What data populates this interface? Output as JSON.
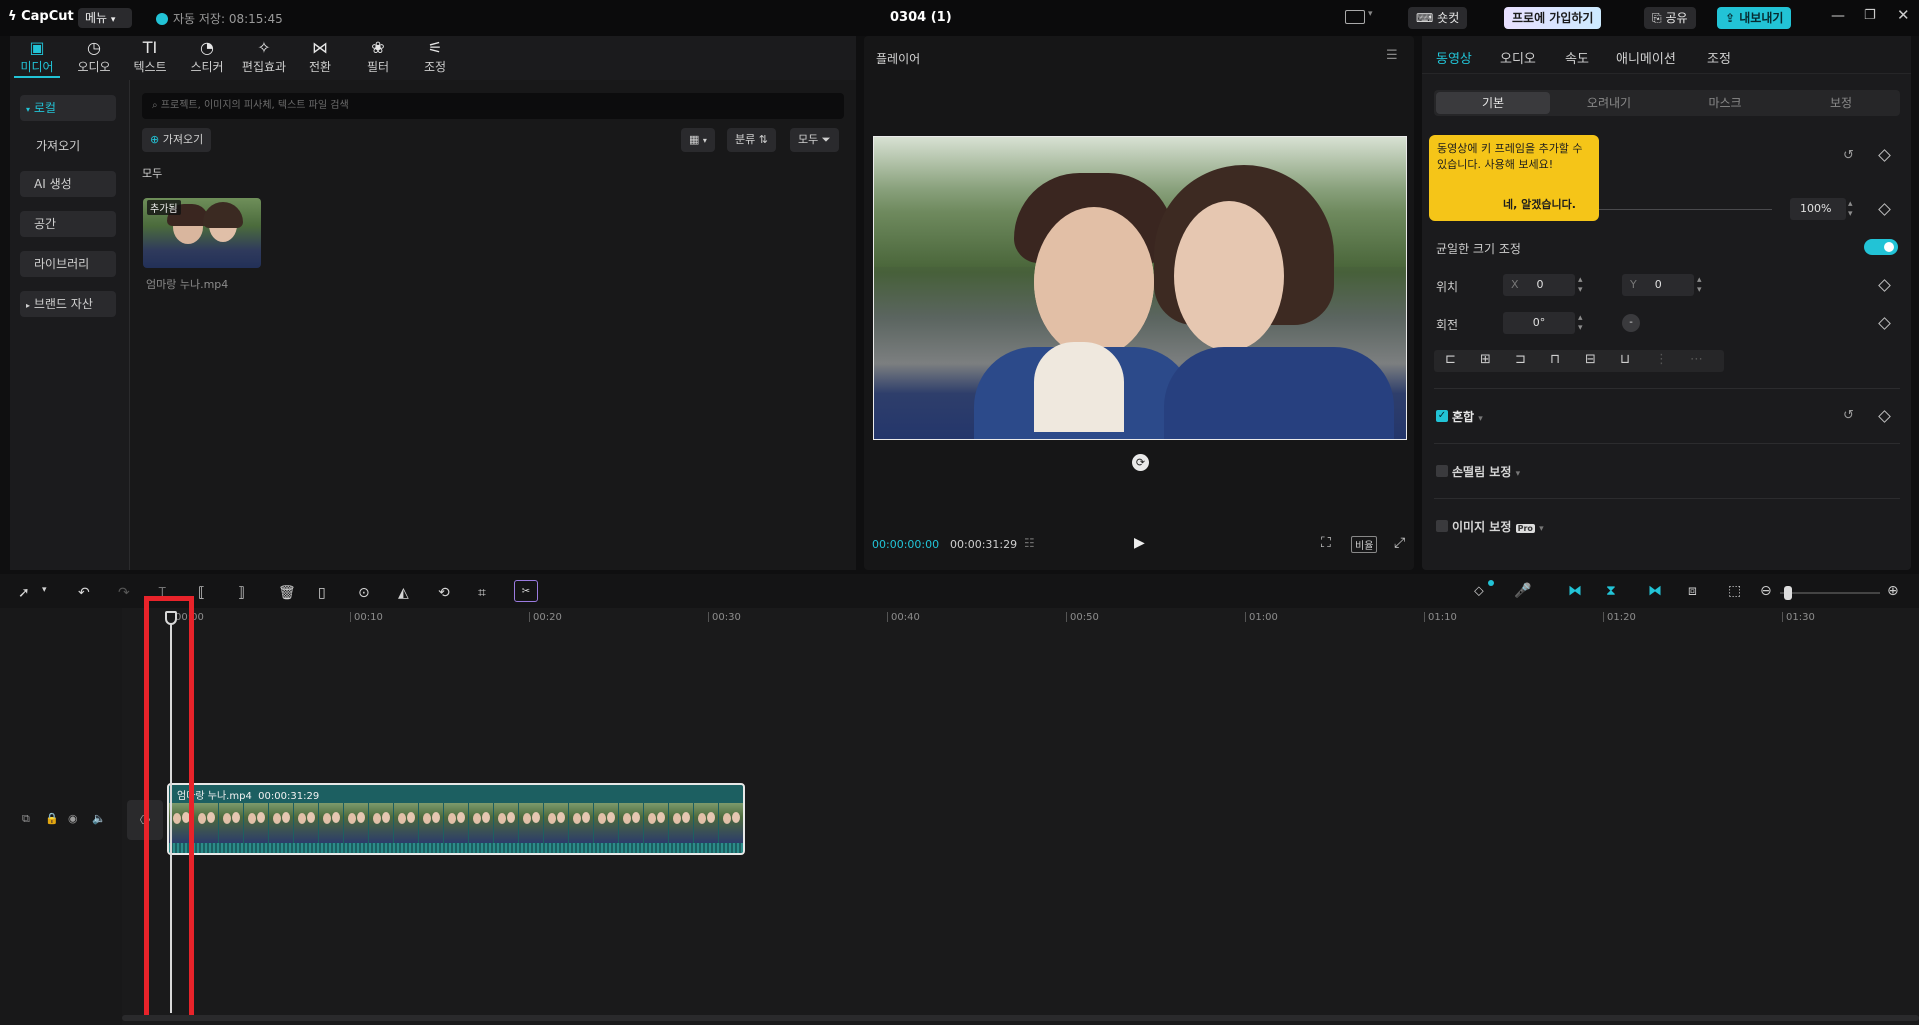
{
  "titlebar": {
    "logo": "CapCut",
    "menu": "메뉴",
    "autosave": "자동 저장: 08:15:45",
    "project_title": "0304 (1)",
    "shortcut": "숏컷",
    "pro": "프로에 가입하기",
    "share": "공유",
    "export": "내보내기"
  },
  "media_tabs": [
    {
      "label": "미디어",
      "icon": "media-icon",
      "glyph": "▣"
    },
    {
      "label": "오디오",
      "icon": "audio-icon",
      "glyph": "◷"
    },
    {
      "label": "텍스트",
      "icon": "text-icon",
      "glyph": "TI"
    },
    {
      "label": "스티커",
      "icon": "sticker-icon",
      "glyph": "◔"
    },
    {
      "label": "편집효과",
      "icon": "effects-icon",
      "glyph": "✧"
    },
    {
      "label": "전환",
      "icon": "transition-icon",
      "glyph": "⋈"
    },
    {
      "label": "필터",
      "icon": "filter-icon",
      "glyph": "❀"
    },
    {
      "label": "조정",
      "icon": "adjust-icon",
      "glyph": "⚟"
    }
  ],
  "sidebar": {
    "local": "로컬",
    "import": "가져오기",
    "ai": "AI 생성",
    "space": "공간",
    "library": "라이브러리",
    "brand": "브랜드 자산"
  },
  "media": {
    "search_placeholder": "프로젝트, 이미지의 피사체, 텍스트 파일 검색",
    "import_btn": "가져오기",
    "sort": "분류",
    "all_filter": "모두",
    "section": "모두",
    "added_badge": "추가됨",
    "file_name": "엄마랑 누나.mp4"
  },
  "player": {
    "title": "플레이어",
    "current_time": "00:00:00:00",
    "total_time": "00:00:31:29",
    "ratio": "비율"
  },
  "inspector": {
    "tabs": [
      "동영상",
      "오디오",
      "속도",
      "애니메이션",
      "조정"
    ],
    "subtabs": [
      "기본",
      "오려내기",
      "마스크",
      "보정"
    ],
    "tooltip_text": "동영상에 키 프레임을 추가할 수 있습니다. 사용해 보세요!",
    "tooltip_ok": "네, 알겠습니다.",
    "scale_value": "100%",
    "uniform_scale": "균일한 크기 조정",
    "position": "위치",
    "x_label": "X",
    "x_value": "0",
    "y_label": "Y",
    "y_value": "0",
    "rotation": "회전",
    "rotation_value": "0°",
    "blend": "혼합",
    "stabilize": "손떨림 보정",
    "image_correct": "이미지 보정",
    "pro_badge": "Pro"
  },
  "timeline": {
    "ruler": [
      "00:00",
      "00:10",
      "00:20",
      "00:30",
      "00:40",
      "00:50",
      "01:00",
      "01:10",
      "01:20",
      "01:30"
    ],
    "clip_name": "엄마랑 누나.mp4",
    "clip_duration": "00:00:31:29"
  },
  "colors": {
    "accent": "#22c3d6",
    "highlight": "#e8232a",
    "tooltip": "#f5c518"
  }
}
